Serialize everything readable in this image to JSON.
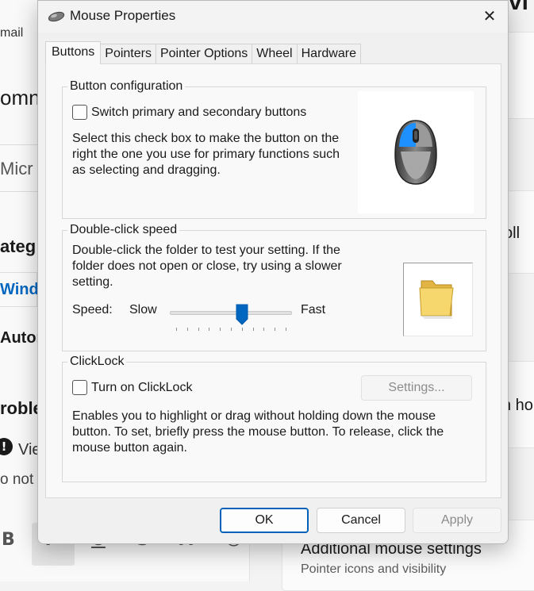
{
  "background": {
    "left_texts": {
      "email": "mail",
      "comm": "omn",
      "micro": "Micr",
      "category": "ateg",
      "windows": "Windo",
      "auto": "Autor",
      "problem": "roble",
      "view": "Vie",
      "not": "o not i"
    },
    "right_texts": {
      "top": "vi",
      "scroll": "oll",
      "how": "n ho",
      "additional_title": "Additional mouse settings",
      "additional_subtitle": "Pointer icons and visibility"
    },
    "format_toolbar": [
      "B",
      "I",
      "U",
      "S",
      "A",
      "☺"
    ]
  },
  "dialog": {
    "title": "Mouse Properties",
    "close_symbol": "✕",
    "tabs": [
      {
        "label": "Buttons",
        "active": true
      },
      {
        "label": "Pointers",
        "active": false
      },
      {
        "label": "Pointer Options",
        "active": false
      },
      {
        "label": "Wheel",
        "active": false
      },
      {
        "label": "Hardware",
        "active": false
      }
    ],
    "button_config": {
      "title": "Button configuration",
      "checkbox_label": "Switch primary and secondary buttons",
      "checked": false,
      "description": "Select this check box to make the button on the right the one you use for primary functions such as selecting and dragging.",
      "desc_lines": [
        "Select this check box to make the button on the",
        "right the one you use for primary functions such",
        "as selecting and dragging."
      ]
    },
    "double_click": {
      "title": "Double-click speed",
      "desc_lines": [
        "Double-click the folder to test your setting. If the",
        "folder does not open or close, try using a slower",
        "setting."
      ],
      "speed_label": "Speed:",
      "slow_label": "Slow",
      "fast_label": "Fast",
      "slider_value_fraction": 0.6,
      "tick_count": 11
    },
    "clicklock": {
      "title": "ClickLock",
      "checkbox_label": "Turn on ClickLock",
      "checked": false,
      "settings_button": "Settings...",
      "desc_lines": [
        "Enables you to highlight or drag without holding down the mouse",
        "button. To set, briefly press the mouse button. To release, click the",
        "mouse button again."
      ]
    },
    "buttons": {
      "ok": "OK",
      "cancel": "Cancel",
      "apply": "Apply"
    }
  },
  "colors": {
    "accent": "#005fb8",
    "slider_thumb": "#0067c0",
    "mouse_highlight": "#1e90ff",
    "folder": "#f5d76e"
  }
}
